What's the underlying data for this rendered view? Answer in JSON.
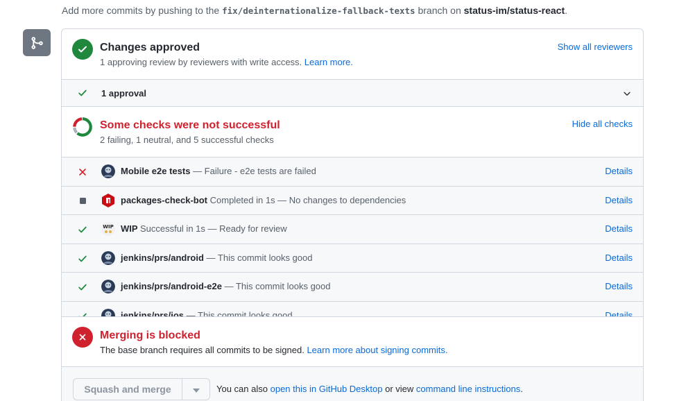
{
  "hint": {
    "prefix": "Add more commits by pushing to the",
    "branch": "fix/deinternationalize-fallback-texts",
    "middle": "branch on",
    "repo": "status-im/status-react",
    "suffix": "."
  },
  "approved": {
    "title": "Changes approved",
    "subtitle": "1 approving review by reviewers with write access.",
    "learn_more": "Learn more.",
    "show_reviewers": "Show all reviewers"
  },
  "approvals": {
    "label": "1 approval"
  },
  "checks": {
    "title": "Some checks were not successful",
    "subtitle": "2 failing, 1 neutral, and 5 successful checks",
    "hide_checks": "Hide all checks",
    "details_label": "Details",
    "items": [
      {
        "status": "fail",
        "name": "Mobile e2e tests",
        "desc": "— Failure - e2e tests are failed",
        "avatar": "jenkins-avatar"
      },
      {
        "status": "neutral",
        "name": "packages-check-bot",
        "desc": "Completed in 1s — No changes to dependencies",
        "avatar": "npm-avatar"
      },
      {
        "status": "success",
        "name": "WIP",
        "desc": "Successful in 1s — Ready for review",
        "avatar": "wip-avatar"
      },
      {
        "status": "success",
        "name": "jenkins/prs/android",
        "desc": "— This commit looks good",
        "avatar": "jenkins-avatar"
      },
      {
        "status": "success",
        "name": "jenkins/prs/android-e2e",
        "desc": "— This commit looks good",
        "avatar": "jenkins-avatar"
      },
      {
        "status": "success",
        "name": "jenkins/prs/ios",
        "desc": "— This commit looks good",
        "avatar": "jenkins-avatar"
      }
    ],
    "donut": {
      "failing": 2,
      "neutral": 1,
      "successful": 5
    }
  },
  "blocked": {
    "title": "Merging is blocked",
    "subtitle": "The base branch requires all commits to be signed.",
    "learn_more": "Learn more about signing commits."
  },
  "merge": {
    "button": "Squash and merge",
    "also_prefix": "You can also",
    "desktop_link": "open this in GitHub Desktop",
    "or_view": "or view",
    "cli_link": "command line instructions",
    "suffix": "."
  },
  "colors": {
    "success": "#1f883d",
    "danger": "#cf222e",
    "neutral": "#57606a",
    "link": "#0969da"
  }
}
